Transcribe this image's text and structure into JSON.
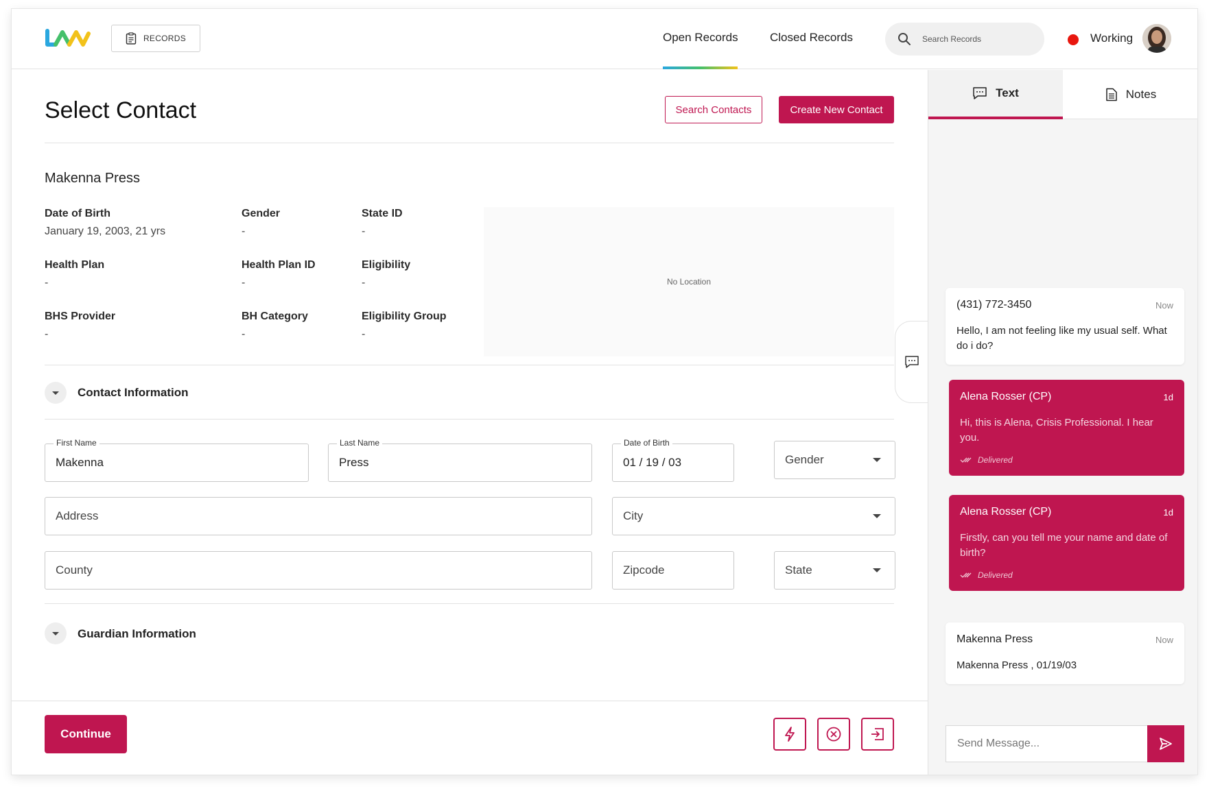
{
  "header": {
    "records_label": "RECORDS",
    "tabs": [
      {
        "label": "Open Records"
      },
      {
        "label": "Closed Records"
      }
    ],
    "search_placeholder": "Search Records",
    "status": "Working",
    "status_color": "#e8170e"
  },
  "main": {
    "title": "Select Contact",
    "search_contacts_label": "Search Contacts",
    "create_contact_label": "Create New Contact",
    "contact_name": "Makenna Press",
    "details": {
      "dob_label": "Date of Birth",
      "dob_value": "January 19, 2003, 21 yrs",
      "gender_label": "Gender",
      "gender_value": "-",
      "state_id_label": "State ID",
      "state_id_value": "-",
      "health_plan_label": "Health Plan",
      "health_plan_value": "-",
      "health_plan_id_label": "Health Plan ID",
      "health_plan_id_value": "-",
      "eligibility_label": "Eligibility",
      "eligibility_value": "-",
      "bhs_provider_label": "BHS Provider",
      "bhs_provider_value": "-",
      "bh_category_label": "BH Category",
      "bh_category_value": "-",
      "eligibility_group_label": "Eligibility Group",
      "eligibility_group_value": "-"
    },
    "map_text": "No Location",
    "contact_section_title": "Contact Information",
    "guardian_section_title": "Guardian Information",
    "form": {
      "first_name_label": "First Name",
      "first_name_value": "Makenna",
      "last_name_label": "Last Name",
      "last_name_value": "Press",
      "dob_label": "Date of Birth",
      "dob_value": "01 / 19 / 03",
      "gender_placeholder": "Gender",
      "address_placeholder": "Address",
      "city_placeholder": "City",
      "county_placeholder": "County",
      "zipcode_placeholder": "Zipcode",
      "state_placeholder": "State"
    }
  },
  "footer": {
    "continue_label": "Continue"
  },
  "panel": {
    "tabs": [
      {
        "label": "Text"
      },
      {
        "label": "Notes"
      }
    ],
    "messages": [
      {
        "sender": "(431) 772-3450",
        "time": "Now",
        "body": "Hello, I am not feeling like my usual self. What do i do?"
      },
      {
        "sender": "Alena Rosser (CP)",
        "time": "1d",
        "body": "Hi, this is Alena, Crisis Professional. I hear you.",
        "status": "Delivered"
      },
      {
        "sender": "Alena Rosser (CP)",
        "time": "1d",
        "body": "Firstly, can you tell me your name and date of birth?",
        "status": "Delivered"
      },
      {
        "sender": "Makenna Press",
        "time": "Now",
        "body": "Makenna Press , 01/19/03"
      }
    ],
    "composer_placeholder": "Send Message..."
  },
  "colors": {
    "accent": "#bf1650"
  }
}
